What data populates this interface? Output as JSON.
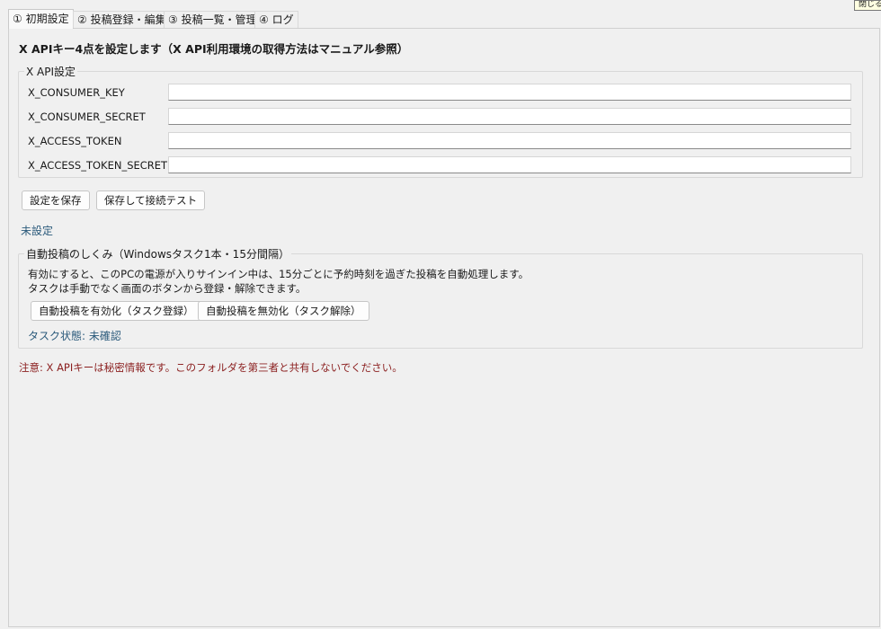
{
  "tabs": [
    {
      "label": "① 初期設定"
    },
    {
      "label": "② 投稿登録・編集"
    },
    {
      "label": "③ 投稿一覧・管理"
    },
    {
      "label": "④ ログ"
    }
  ],
  "corner_label": "閉じる",
  "heading": "X APIキー4点を設定します（X API利用環境の取得方法はマニュアル参照）",
  "api_group": {
    "title": "X API設定",
    "fields": [
      {
        "label": "X_CONSUMER_KEY",
        "value": ""
      },
      {
        "label": "X_CONSUMER_SECRET",
        "value": ""
      },
      {
        "label": "X_ACCESS_TOKEN",
        "value": ""
      },
      {
        "label": "X_ACCESS_TOKEN_SECRET",
        "value": ""
      }
    ]
  },
  "buttons": {
    "save": "設定を保存",
    "save_test": "保存して接続テスト"
  },
  "config_status": "未設定",
  "auto_group": {
    "title": "自動投稿のしくみ（Windowsタスク1本・15分間隔）",
    "desc_line1": "有効にすると、このPCの電源が入りサインイン中は、15分ごとに予約時刻を過ぎた投稿を自動処理します。",
    "desc_line2": "タスクは手動でなく画面のボタンから登録・解除できます。",
    "enable_button": "自動投稿を有効化（タスク登録）",
    "disable_button": "自動投稿を無効化（タスク解除）",
    "task_status": "タスク状態: 未確認"
  },
  "warning": "注意: X APIキーは秘密情報です。このフォルダを第三者と共有しないでください。",
  "colors": {
    "status_text": "#2b5a7b",
    "warning_text": "#8b1f1f"
  }
}
